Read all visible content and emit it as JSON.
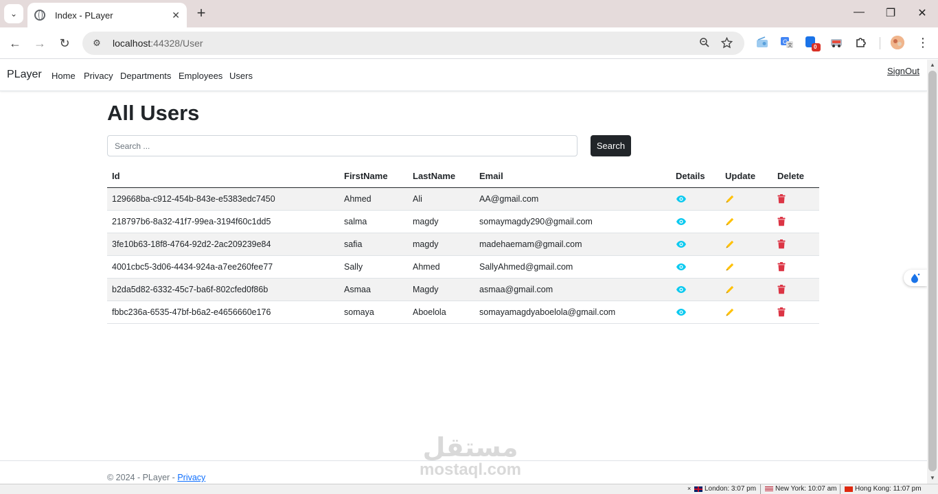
{
  "browser": {
    "tab_title": "Index - PLayer",
    "url_host": "localhost",
    "url_path": ":44328/User",
    "extension_badge": "0"
  },
  "nav": {
    "brand": "PLayer",
    "links": [
      "Home",
      "Privacy",
      "Departments",
      "Employees",
      "Users"
    ],
    "signout": "SignOut"
  },
  "main": {
    "title": "All Users",
    "search_placeholder": "Search ...",
    "search_button": "Search",
    "columns": [
      "Id",
      "FirstName",
      "LastName",
      "Email",
      "Details",
      "Update",
      "Delete"
    ],
    "rows": [
      {
        "id": "129668ba-c912-454b-843e-e5383edc7450",
        "first": "Ahmed",
        "last": "Ali",
        "email": "AA@gmail.com"
      },
      {
        "id": "218797b6-8a32-41f7-99ea-3194f60c1dd5",
        "first": "salma",
        "last": "magdy",
        "email": "somaymagdy290@gmail.com"
      },
      {
        "id": "3fe10b63-18f8-4764-92d2-2ac209239e84",
        "first": "safia",
        "last": "magdy",
        "email": "madehaemam@gmail.com"
      },
      {
        "id": "4001cbc5-3d06-4434-924a-a7ee260fee77",
        "first": "Sally",
        "last": "Ahmed",
        "email": "SallyAhmed@gmail.com"
      },
      {
        "id": "b2da5d82-6332-45c7-ba6f-802cfed0f86b",
        "first": "Asmaa",
        "last": "Magdy",
        "email": "asmaa@gmail.com"
      },
      {
        "id": "fbbc236a-6535-47bf-b6a2-e4656660e176",
        "first": "somaya",
        "last": "Aboelola",
        "email": "somayamagdyaboelola@gmail.com"
      }
    ],
    "icons": {
      "details": "eye-icon",
      "update": "pencil-icon",
      "delete": "trash-icon"
    },
    "colors": {
      "details": "#0dcaf0",
      "update": "#ffc107",
      "delete": "#dc3545"
    }
  },
  "footer": {
    "text": "© 2024 - PLayer - ",
    "link": "Privacy"
  },
  "watermark": {
    "arabic": "مستقل",
    "latin": "mostaql.com"
  },
  "status": {
    "clocks": [
      "London: 3:07 pm",
      "New York: 10:07 am",
      "Hong Kong: 11:07 pm"
    ]
  }
}
